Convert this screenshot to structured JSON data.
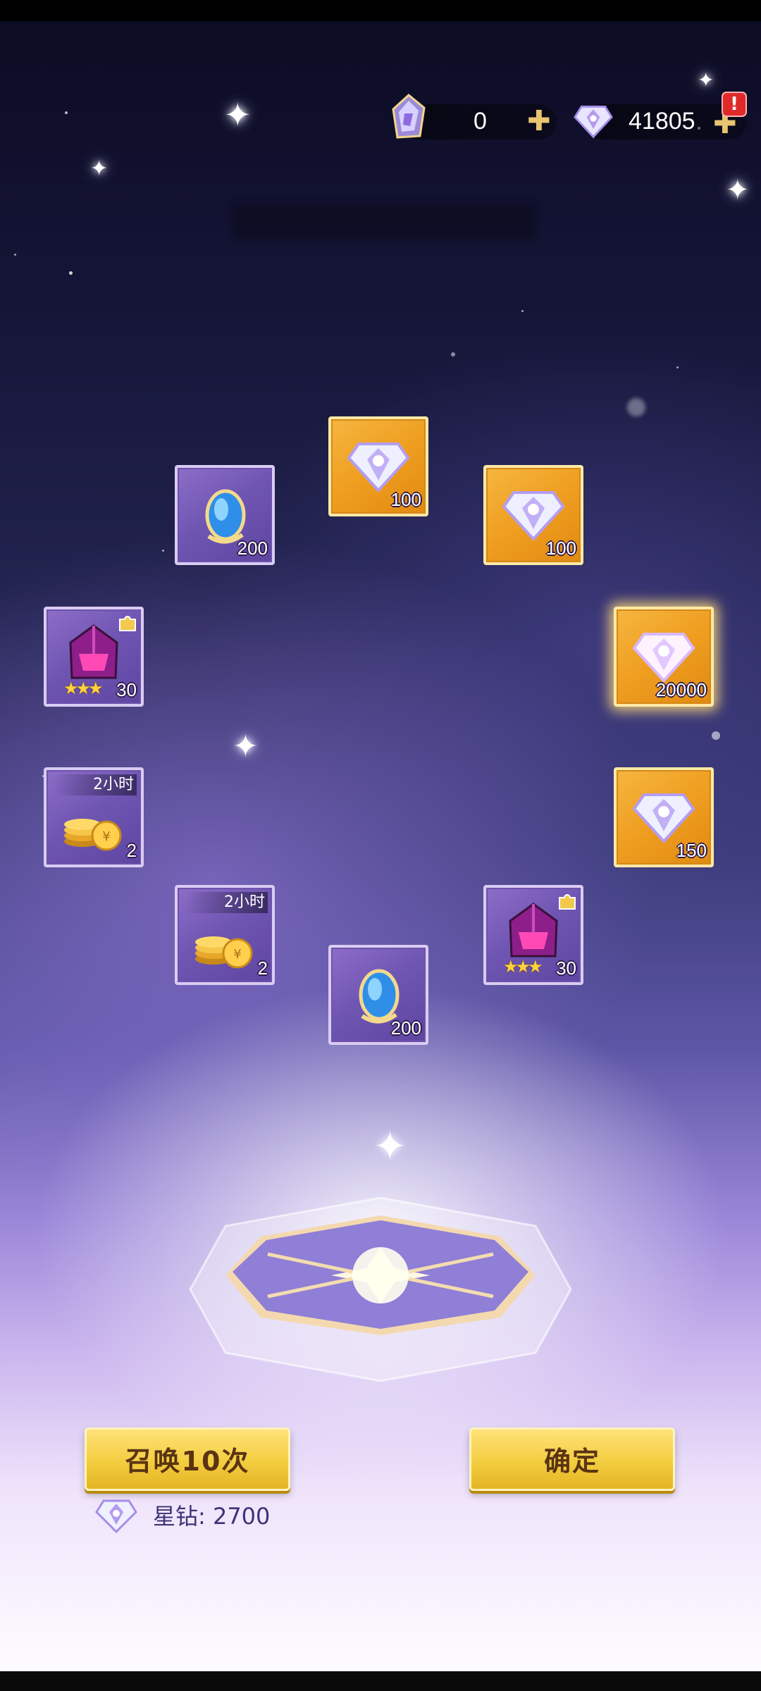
{
  "currency": {
    "ticket_value": "0",
    "diamond_value": "41805",
    "ticket_icon": "crystal-ticket-icon",
    "diamond_icon": "star-diamond-icon",
    "plus_icon": "plus-icon",
    "alert_icon": "!"
  },
  "rewards": [
    {
      "id": "r1",
      "kind": "essence",
      "style": "purple",
      "quantity": "200"
    },
    {
      "id": "r2",
      "kind": "diamond",
      "style": "gold",
      "quantity": "100"
    },
    {
      "id": "r3",
      "kind": "diamond",
      "style": "gold",
      "quantity": "100"
    },
    {
      "id": "r4",
      "kind": "helmet-shard",
      "style": "purple",
      "quantity": "30",
      "stars": "★★★"
    },
    {
      "id": "r5",
      "kind": "diamond",
      "style": "gold",
      "quantity": "20000",
      "highlight": true
    },
    {
      "id": "r6",
      "kind": "gold-coins",
      "style": "purple",
      "quantity": "2",
      "time_label": "2小时"
    },
    {
      "id": "r7",
      "kind": "diamond",
      "style": "gold",
      "quantity": "150"
    },
    {
      "id": "r8",
      "kind": "gold-coins",
      "style": "purple",
      "quantity": "2",
      "time_label": "2小时"
    },
    {
      "id": "r9",
      "kind": "helmet-shard",
      "style": "purple",
      "quantity": "30",
      "stars": "★★★"
    },
    {
      "id": "r10",
      "kind": "essence",
      "style": "purple",
      "quantity": "200"
    }
  ],
  "actions": {
    "summon_label": "召唤10次",
    "confirm_label": "确定"
  },
  "cost": {
    "label": "星钻: 2700",
    "icon": "star-diamond-icon"
  },
  "colors": {
    "button_gold": "#f3cd3f",
    "tile_gold": "#ef9e20",
    "tile_purple": "#7056b3"
  }
}
